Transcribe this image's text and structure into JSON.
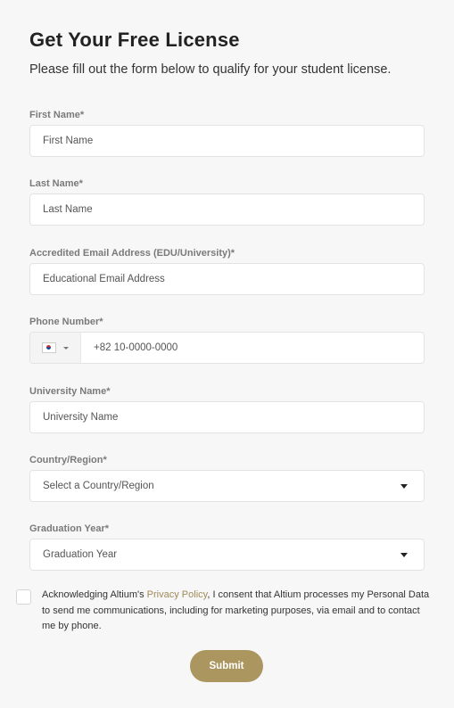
{
  "header": {
    "title": "Get Your Free License",
    "subtitle": "Please fill out the form below to qualify for your student license."
  },
  "form": {
    "first_name": {
      "label": "First Name*",
      "placeholder": "First Name"
    },
    "last_name": {
      "label": "Last Name*",
      "placeholder": "Last Name"
    },
    "email": {
      "label": "Accredited Email Address (EDU/University)*",
      "placeholder": "Educational Email Address"
    },
    "phone": {
      "label": "Phone Number*",
      "placeholder": "+82 10-0000-0000",
      "flag_icon": "south-korea-flag-icon"
    },
    "university": {
      "label": "University Name*",
      "placeholder": "University Name"
    },
    "country": {
      "label": "Country/Region*",
      "value": "Select a Country/Region"
    },
    "graduation": {
      "label": "Graduation Year*",
      "value": "Graduation Year"
    },
    "consent": {
      "before_link": "Acknowledging Altium's ",
      "link": "Privacy Policy",
      "after_link": ", I consent that Altium processes my Personal Data to send me communications, including for marketing purposes, via email and to contact me by phone."
    },
    "submit_label": "Submit"
  },
  "colors": {
    "accent": "#ac9660",
    "link": "#a08a5a",
    "background": "#f7f7f7"
  }
}
